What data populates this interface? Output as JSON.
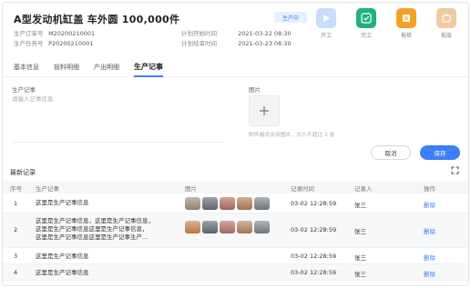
{
  "header": {
    "title": "A型发动机缸盖 车外圆 100,000件",
    "status_badge": "生产中",
    "left_meta": [
      {
        "label": "生产订单号",
        "value": "M20200210001"
      },
      {
        "label": "生产任务号",
        "value": "P20200210001"
      }
    ],
    "right_meta": [
      {
        "label": "计划开始时间",
        "value": "2021-03-22 08:30"
      },
      {
        "label": "计划结束时间",
        "value": "2021-03-23 08:30"
      }
    ],
    "actions": [
      {
        "label": "开工",
        "icon": "play-icon",
        "color": "#c9dcf9"
      },
      {
        "label": "完工",
        "icon": "check-icon",
        "color": "#22b07d"
      },
      {
        "label": "报修",
        "icon": "wrench-icon",
        "color": "#f5a025"
      },
      {
        "label": "报废",
        "icon": "trash-icon",
        "color": "#f3c9a0"
      }
    ]
  },
  "tabs": [
    "基本信息",
    "投料明细",
    "产出明细",
    "生产记事"
  ],
  "form": {
    "note_label": "生产记事",
    "note_placeholder": "请输入记事信息",
    "image_label": "图片",
    "upload_icon": "plus-icon",
    "upload_hint": "附件格式支持图片，大小不超过 3 张",
    "cancel_label": "取消",
    "submit_label": "保存"
  },
  "records": {
    "title": "最新记录",
    "expand_icon": "expand-icon",
    "columns": [
      "序号",
      "生产记事",
      "图片",
      "记录时间",
      "记录人",
      "操作"
    ],
    "rows": [
      {
        "no": "1",
        "desc": [
          "这里是生产记事信息"
        ],
        "images": 5,
        "time": "03-02 12:28:59",
        "person": "张三",
        "action": "删除"
      },
      {
        "no": "2",
        "desc": [
          "这里是生产记事信息，这里是生产记事信息，",
          "这里是生产记事信息这里是生产记事信息，",
          "这里是生产记事信息这里是生产记事生产..."
        ],
        "images": 5,
        "time": "03-02 12:28:59",
        "person": "张三",
        "action": "删除"
      },
      {
        "no": "3",
        "desc": [
          "这里是生产记事信息"
        ],
        "images": 0,
        "time": "03-02 12:28:59",
        "person": "张三",
        "action": "删除"
      },
      {
        "no": "4",
        "desc": [
          "这里是生产记事信息"
        ],
        "images": 0,
        "time": "03-02 12:28:59",
        "person": "张三",
        "action": "删除"
      }
    ]
  }
}
